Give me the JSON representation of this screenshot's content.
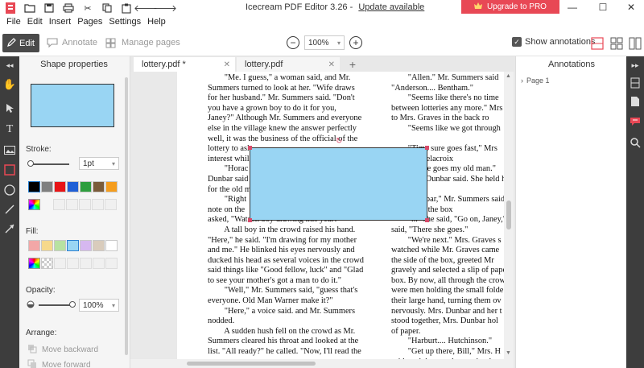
{
  "window": {
    "title": "Icecream PDF Editor 3.26 -",
    "update_link": "Update available",
    "upgrade_label": "Upgrade to PRO"
  },
  "menu": [
    "File",
    "Edit",
    "Insert",
    "Pages",
    "Settings",
    "Help"
  ],
  "toolbar": {
    "edit_label": "Edit",
    "annotate_label": "Annotate",
    "manage_pages_label": "Manage pages",
    "zoom_value": "100%",
    "show_annotations_label": "Show annotations"
  },
  "shape_panel": {
    "title": "Shape properties",
    "stroke_label": "Stroke:",
    "stroke_width": "1pt",
    "stroke_colors": [
      "#000000",
      "#7f7f7f",
      "#e81416",
      "#1f5fd6",
      "#2e9e3e",
      "#7a5b3a",
      "#f59d1d"
    ],
    "fill_label": "Fill:",
    "fill_colors": [
      "#f2a7a7",
      "#f6d98c",
      "#b8e2a1",
      "#99d5f3",
      "#d6b8f0",
      "#d9ccbc",
      "#ffffff"
    ],
    "opacity_label": "Opacity:",
    "opacity_value": "100%",
    "arrange_label": "Arrange:",
    "move_backward": "Move backward",
    "move_forward": "Move forward",
    "preview_fill": "#99d5f3"
  },
  "tabs": [
    {
      "label": "lottery.pdf *"
    },
    {
      "label": "lottery.pdf"
    }
  ],
  "document": {
    "left_column": [
      "        \"Me. I guess,\" a woman said, and Mr.",
      "Summers turned to look at her. \"Wife draws",
      "for her husband.\" Mr. Summers said. \"Don't",
      "you have a grown boy to do it for you,",
      "Janey?\" Although Mr. Summers and everyone",
      "else in the village knew the answer perfectly",
      "well, it was the business of the official of the",
      "lottery to ask",
      "interest whil",
      "        \"Horac",
      "Dunbar said",
      "for the old m",
      "        \"Right",
      "note on the",
      "asked, \"Watson boy drawing this year?\"",
      "        A tall boy in the crowd raised his hand.",
      "\"Here,\" he said. \"I'm drawing for my mother",
      "and me.\" He blinked his eyes nervously and",
      "ducked his head as several voices in the crowd",
      "said things like \"Good fellow, luck\" and \"Glad",
      "to see your mother's got a man to do it.\"",
      "        \"Well,\" Mr. Summers said, \"guess that's",
      "everyone. Old Man Warner make it?\"",
      "        \"Here,\" a voice said. and Mr. Summers",
      "nodded.",
      "        A sudden hush fell on the crowd as Mr.",
      "Summers cleared his throat and looked at the",
      "list. \"All ready?\" he called. \"Now, I'll read the"
    ],
    "right_column": [
      "        \"Allen.\" Mr. Summers said",
      "\"Anderson.... Bentham.\"",
      "        \"Seems like there's no time",
      "between lotteries any more.\" Mrs",
      "to Mrs. Graves in the back ro",
      "        \"Seems like we got through",
      "",
      "        \"Time sure goes fast,\" Mrs",
      "Clark.... Delacroix",
      "        \"There goes my old man.\"",
      "        Mrs. Dunbar said. She held her brea",
      "forward.",
      "        \"Dunbar,\" Mr. Summers said",
      "steadily to the box",
      "        \"...\" she said, \"Go on, Janey,\"",
      "said, \"There she goes.\"",
      "        \"We're next.\" Mrs. Graves s",
      "watched while Mr. Graves came",
      "the side of the box, greeted Mr",
      "gravely and selected a slip of pape",
      "box. By now, all through the crow",
      "were men holding the small folde",
      "their large hand, turning them ov",
      "nervously. Mrs. Dunbar and her t",
      "stood together, Mrs. Dunbar hol",
      "of paper.",
      "        \"Harburt.... Hutchinson.\"",
      "        \"Get up there, Bill,\" Mrs. H",
      "said. and the people near her lau"
    ],
    "shape_fill": "#99d5f3",
    "handle_color": "#d84b6a"
  },
  "annotations_panel": {
    "title": "Annotations",
    "page_item": "Page 1"
  }
}
